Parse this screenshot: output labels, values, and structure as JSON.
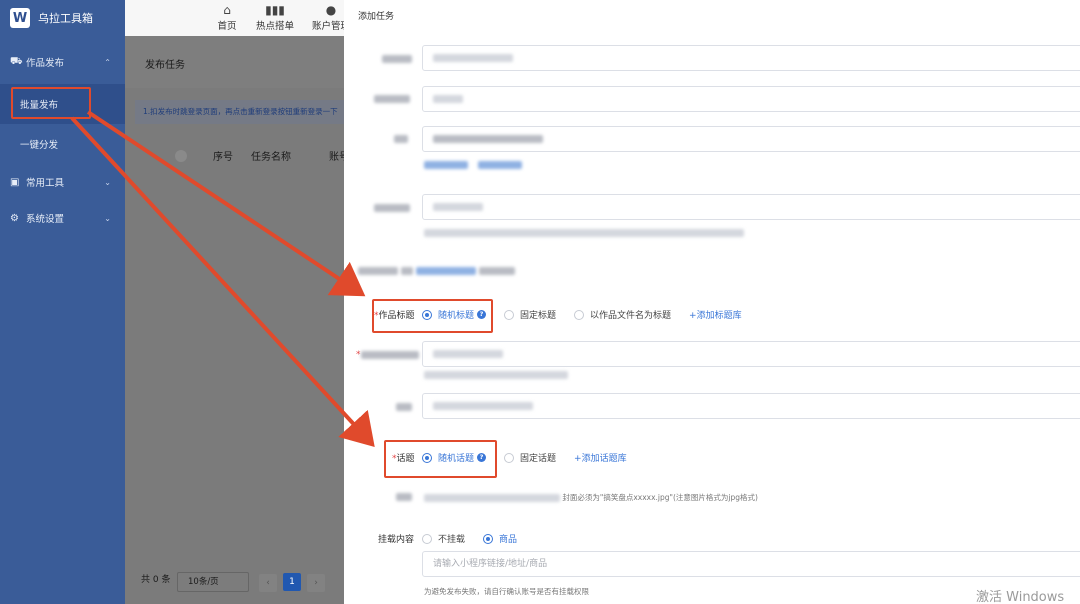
{
  "app": {
    "logo_letter": "W",
    "name": "乌拉工具箱"
  },
  "sidebar": {
    "groups": [
      {
        "label": "作品发布",
        "icon": "truck-icon",
        "arrow": "⌃"
      },
      {
        "label": "常用工具",
        "icon": "briefcase-icon",
        "arrow": "⌄"
      },
      {
        "label": "系统设置",
        "icon": "gear-icon",
        "arrow": "⌄"
      }
    ],
    "items": [
      {
        "label": "批量发布",
        "active": true
      },
      {
        "label": "一键分发",
        "active": false
      }
    ]
  },
  "topnav": {
    "items": [
      {
        "label": "首页",
        "icon": "home-icon"
      },
      {
        "label": "热点搭单",
        "icon": "bar-chart-icon"
      },
      {
        "label": "账户管理",
        "icon": "user-icon"
      }
    ]
  },
  "page": {
    "title": "发布任务",
    "notice": "1.扣发布时跳登录页面，再点击重新登录按钮重新登录一下",
    "table_headers": [
      "序号",
      "任务名称",
      "账号"
    ],
    "pager": {
      "total": "共 0 条",
      "page_size": "10条/页",
      "current": "1",
      "prev": "‹",
      "next": "›"
    }
  },
  "drawer": {
    "title": "添加任务",
    "fields": {
      "title_label": "作品标题",
      "title_options": [
        "随机标题",
        "固定标题",
        "以作品文件名为标题"
      ],
      "title_add_link": "+添加标题库",
      "topic_label": "话题",
      "topic_options": [
        "随机话题",
        "固定话题"
      ],
      "topic_add_link": "+添加话题库",
      "cover_hint": "封面必须为\"搞笑盘点xxxxx.jpg\"(注意图片格式为jpg格式)",
      "mount_label": "挂载内容",
      "mount_options": [
        "不挂载",
        "商品"
      ],
      "mount_placeholder": "请输入小程序链接/地址/商品",
      "mount_hint": "为避免发布失败，请自行确认账号是否有挂载权限"
    }
  },
  "colors": {
    "sidebar": "#3a5c98",
    "accent": "#3976d7",
    "annotation": "#e04a2c"
  },
  "watermark": "激活 Windows"
}
